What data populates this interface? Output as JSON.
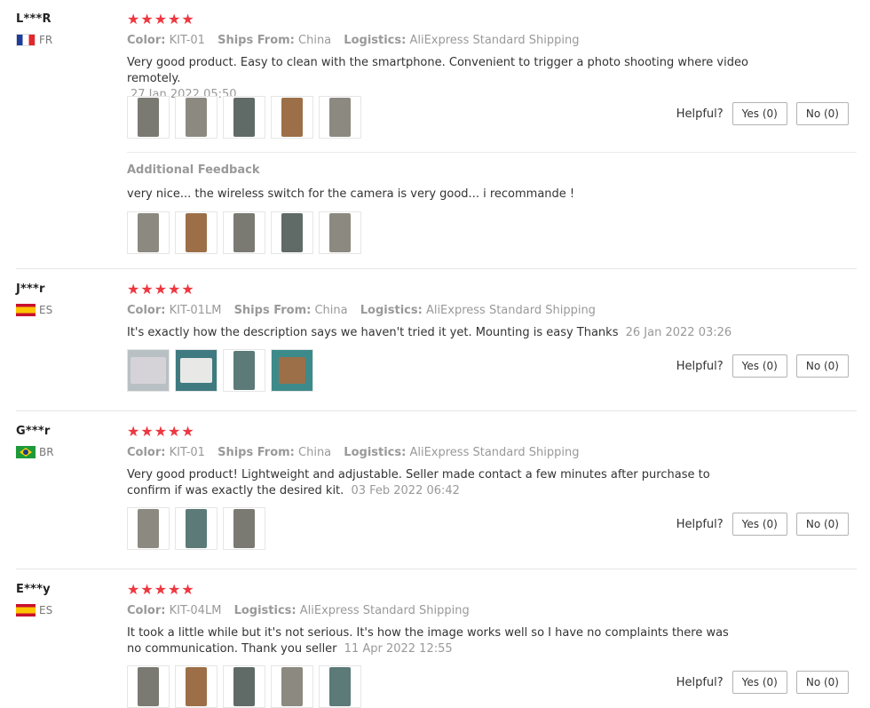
{
  "helpful_label": "Helpful?",
  "yes_label": "Yes (0)",
  "no_label": "No (0)",
  "labels": {
    "color": "Color:",
    "ships_from": "Ships From:",
    "logistics": "Logistics:"
  },
  "stars": "★★★★★",
  "reviews": [
    {
      "user": "L***R",
      "country": "FR",
      "color": "KIT-01",
      "ships_from": "China",
      "logistics": "AliExpress Standard Shipping",
      "text": "Very good product. Easy to clean with the smartphone. Convenient to trigger a photo shooting where video remotely.",
      "date": "27 Jan 2022 05:50",
      "photos": 5,
      "additional_title": "Additional Feedback",
      "additional_text": "very nice... the wireless switch for the camera is very good... i recommande !"
    },
    {
      "user": "J***r",
      "country": "ES",
      "color": "KIT-01LM",
      "ships_from": "China",
      "logistics": "AliExpress Standard Shipping",
      "text": "It's exactly how the description says we haven't tried it yet. Mounting is easy Thanks",
      "date": "26 Jan 2022 03:26"
    },
    {
      "user": "G***r",
      "country": "BR",
      "color": "KIT-01",
      "ships_from": "China",
      "logistics": "AliExpress Standard Shipping",
      "text": "Very good product! Lightweight and adjustable. Seller made contact a few minutes after purchase to confirm if was exactly the desired kit.",
      "date": "03 Feb 2022 06:42"
    },
    {
      "user": "E***y",
      "country": "ES",
      "color": "KIT-04LM",
      "logistics": "AliExpress Standard Shipping",
      "text": "It took a little while but it's not serious. It's how the image works well so I have no complaints there was no communication. Thank you seller",
      "date": "11 Apr 2022 12:55"
    }
  ]
}
